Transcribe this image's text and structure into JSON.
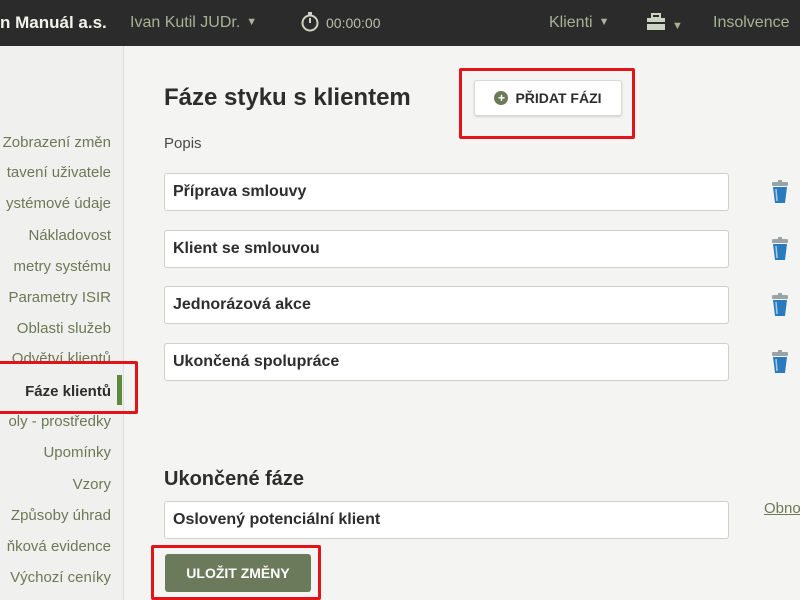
{
  "topbar": {
    "brand": "n Manuál a.s.",
    "user": "Ivan Kutil JUDr.",
    "timer": "00:00:00",
    "clients": "Klienti",
    "insolvence": "Insolvence",
    "icons": [
      "stopwatch-icon",
      "toolbox-icon",
      "chevron-down-icon"
    ]
  },
  "sidebar": {
    "items": [
      {
        "label": "Zobrazení změn"
      },
      {
        "label": "tavení uživatele"
      },
      {
        "label": "ystémové údaje"
      },
      {
        "label": "Nákladovost"
      },
      {
        "label": "metry systému"
      },
      {
        "label": "Parametry ISIR"
      },
      {
        "label": "Oblasti služeb"
      },
      {
        "label": "Odvětví klientů"
      },
      {
        "label": "Fáze klientů",
        "active": true
      },
      {
        "label": "oly - prostředky"
      },
      {
        "label": "Upomínky"
      },
      {
        "label": "Vzory"
      },
      {
        "label": "Způsoby úhrad"
      },
      {
        "label": "ňková evidence"
      },
      {
        "label": "Výchozí ceníky"
      }
    ]
  },
  "main": {
    "title": "Fáze styku s klientem",
    "add_button": "PŘIDAT FÁZI",
    "column_label": "Popis",
    "phases": [
      {
        "value": "Příprava smlouvy"
      },
      {
        "value": "Klient se smlouvou"
      },
      {
        "value": "Jednorázová akce"
      },
      {
        "value": "Ukončená spolupráce"
      }
    ],
    "ended_title": "Ukončené fáze",
    "ended_phases": [
      {
        "value": "Oslovený potenciální klient"
      }
    ],
    "restore_link": "Obno",
    "save_button": "ULOŽIT ZMĚNY"
  },
  "colors": {
    "topbar_bg": "#2b2b2b",
    "accent_green": "#6b7a5a",
    "active_indicator": "#5f8a3c",
    "highlight_red": "#e3131a"
  }
}
